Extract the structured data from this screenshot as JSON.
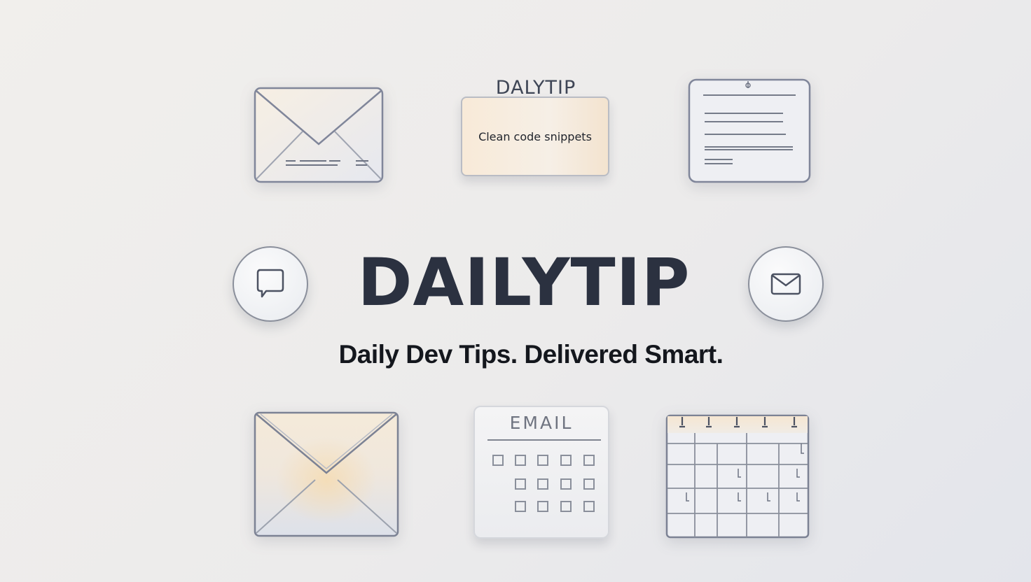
{
  "brand": {
    "title": "DAILYTIP",
    "tagline": "Daily Dev Tips. Delivered Smart."
  },
  "note_card": {
    "label": "DALYTIP",
    "text": "Clean code snippets"
  },
  "email_card": {
    "label": "EMAIL"
  },
  "icons": {
    "top_left": "envelope-icon",
    "top_right": "document-icon",
    "circle_left": "chat-bubble-icon",
    "circle_right": "mail-icon",
    "bottom_left": "envelope-icon",
    "bottom_right": "calendar-icon"
  },
  "colors": {
    "title": "#2b3140",
    "tagline": "#14171d",
    "note_card": "#f6eadc",
    "outline": "#8a8f9b"
  }
}
